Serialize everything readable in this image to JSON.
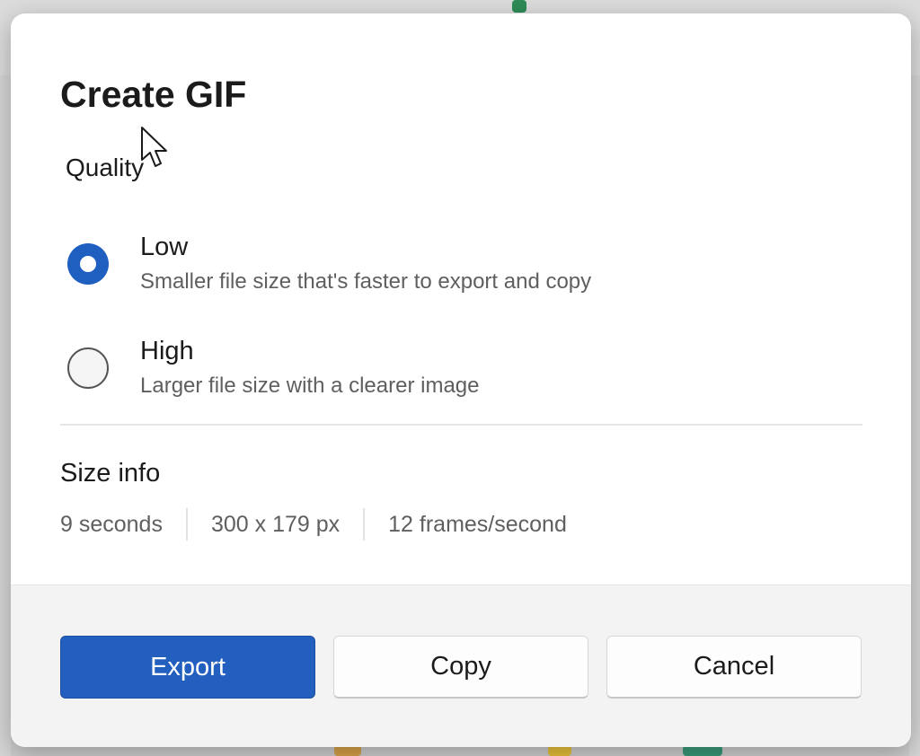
{
  "dialog": {
    "title": "Create GIF",
    "quality": {
      "label": "Quality",
      "options": [
        {
          "title": "Low",
          "description": "Smaller file size that's faster to export and copy",
          "selected": true
        },
        {
          "title": "High",
          "description": "Larger file size with a clearer image",
          "selected": false
        }
      ]
    },
    "size_info": {
      "heading": "Size info",
      "items": [
        "9 seconds",
        "300 x 179 px",
        "12 frames/second"
      ]
    },
    "buttons": {
      "export": "Export",
      "copy": "Copy",
      "cancel": "Cancel"
    }
  },
  "colors": {
    "accent": "#235fbe",
    "radio_selected": "#1f5fbf",
    "footer_bg": "#f3f3f3",
    "text_primary": "#1b1b1b",
    "text_secondary": "#5f5f5f"
  },
  "icons": {
    "radio_selected": "radio-checked-icon",
    "radio_unselected": "radio-unchecked-icon",
    "pointer": "mouse-cursor-icon"
  }
}
